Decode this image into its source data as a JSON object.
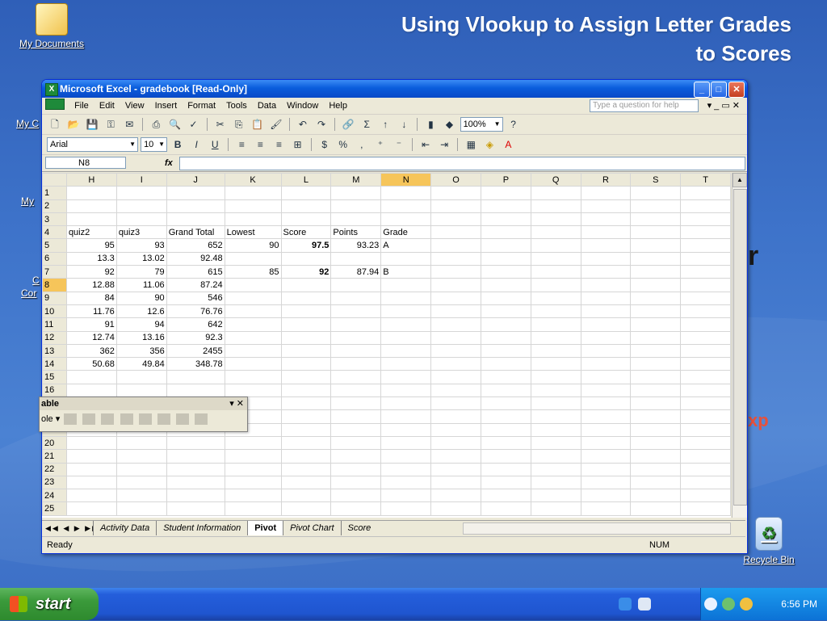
{
  "slide_title": {
    "line1": "Using Vlookup to Assign Letter Grades",
    "line2": "to Scores"
  },
  "desktop": {
    "my_documents": "My Documents",
    "recycle_bin": "Recycle Bin",
    "peek_labels": [
      "My C",
      "My",
      "C",
      "Cor"
    ],
    "bg_fragments": [
      "r",
      "xp"
    ]
  },
  "window": {
    "title": "Microsoft Excel - gradebook  [Read-Only]"
  },
  "menu": {
    "items": [
      "File",
      "Edit",
      "View",
      "Insert",
      "Format",
      "Tools",
      "Data",
      "Window",
      "Help"
    ],
    "help_placeholder": "Type a question for help"
  },
  "toolbar": {
    "zoom": "100%"
  },
  "format_toolbar": {
    "font": "Arial",
    "size": "10"
  },
  "formula_bar": {
    "name_box": "N8",
    "fx": "fx",
    "formula": ""
  },
  "sheet": {
    "columns": [
      "H",
      "I",
      "J",
      "K",
      "L",
      "M",
      "N",
      "O",
      "P",
      "Q",
      "R",
      "S",
      "T"
    ],
    "selected_column": "N",
    "selected_row": 8,
    "active_cell": "N8",
    "rows": [
      {
        "n": 1,
        "cells": [
          "",
          "",
          "",
          "",
          "",
          "",
          ""
        ]
      },
      {
        "n": 2,
        "cells": [
          "",
          "",
          "",
          "",
          "",
          "",
          ""
        ]
      },
      {
        "n": 3,
        "cells": [
          "",
          "",
          "",
          "",
          "",
          "",
          ""
        ]
      },
      {
        "n": 4,
        "cells": [
          "quiz2",
          "quiz3",
          "Grand Total",
          "Lowest",
          "Score",
          "Points",
          "Grade"
        ]
      },
      {
        "n": 5,
        "cells": [
          "95",
          "93",
          "652",
          "90",
          "97.5",
          "93.23",
          "A"
        ]
      },
      {
        "n": 6,
        "cells": [
          "13.3",
          "13.02",
          "92.48",
          "",
          "",
          "",
          ""
        ]
      },
      {
        "n": 7,
        "cells": [
          "92",
          "79",
          "615",
          "85",
          "92",
          "87.94",
          "B"
        ]
      },
      {
        "n": 8,
        "cells": [
          "12.88",
          "11.06",
          "87.24",
          "",
          "",
          "",
          ""
        ]
      },
      {
        "n": 9,
        "cells": [
          "84",
          "90",
          "546",
          "",
          "",
          "",
          ""
        ]
      },
      {
        "n": 10,
        "cells": [
          "11.76",
          "12.6",
          "76.76",
          "",
          "",
          "",
          ""
        ]
      },
      {
        "n": 11,
        "cells": [
          "91",
          "94",
          "642",
          "",
          "",
          "",
          ""
        ]
      },
      {
        "n": 12,
        "cells": [
          "12.74",
          "13.16",
          "92.3",
          "",
          "",
          "",
          ""
        ]
      },
      {
        "n": 13,
        "cells": [
          "362",
          "356",
          "2455",
          "",
          "",
          "",
          ""
        ]
      },
      {
        "n": 14,
        "cells": [
          "50.68",
          "49.84",
          "348.78",
          "",
          "",
          "",
          ""
        ]
      },
      {
        "n": 15,
        "cells": [
          "",
          "",
          "",
          "",
          "",
          "",
          ""
        ]
      },
      {
        "n": 16,
        "cells": [
          "",
          "",
          "",
          "",
          "",
          "",
          ""
        ]
      },
      {
        "n": 17,
        "cells": [
          "",
          "",
          "",
          "",
          "",
          "",
          ""
        ]
      },
      {
        "n": 18,
        "cells": [
          "",
          "",
          "",
          "",
          "",
          "",
          ""
        ]
      },
      {
        "n": 19,
        "cells": [
          "",
          "",
          "",
          "",
          "",
          "",
          ""
        ]
      },
      {
        "n": 20,
        "cells": [
          "",
          "",
          "",
          "",
          "",
          "",
          ""
        ]
      },
      {
        "n": 21,
        "cells": [
          "",
          "",
          "",
          "",
          "",
          "",
          ""
        ]
      },
      {
        "n": 22,
        "cells": [
          "",
          "",
          "",
          "",
          "",
          "",
          ""
        ]
      },
      {
        "n": 23,
        "cells": [
          "",
          "",
          "",
          "",
          "",
          "",
          ""
        ]
      },
      {
        "n": 24,
        "cells": [
          "",
          "",
          "",
          "",
          "",
          "",
          ""
        ]
      },
      {
        "n": 25,
        "cells": [
          "",
          "",
          "",
          "",
          "",
          "",
          ""
        ]
      }
    ],
    "tabs": [
      "Activity Data",
      "Student Information",
      "Pivot",
      "Pivot Chart",
      "Score"
    ],
    "active_tab": "Pivot"
  },
  "pivot_toolbar": {
    "title": "able",
    "dropdown": "ole"
  },
  "status": {
    "ready": "Ready",
    "num": "NUM"
  },
  "taskbar": {
    "start": "start",
    "clock": "6:56 PM"
  },
  "colors": {
    "desktop": "#3d72c9",
    "title_text": "#ffffff",
    "fragment_red": "#e8503a",
    "fragment_dark": "#1a1a1a"
  }
}
